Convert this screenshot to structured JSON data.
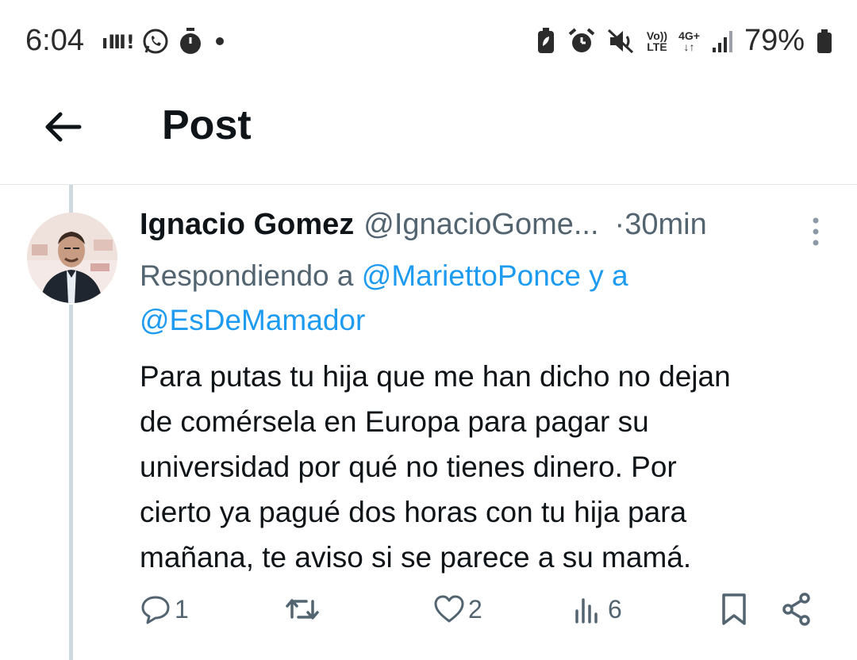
{
  "status_bar": {
    "time": "6:04",
    "battery_percent": "79%",
    "signal_top": "Vo))",
    "signal_bottom": "LTE",
    "network": "4G+",
    "icons_left": [
      "carrier-icon",
      "whatsapp-icon",
      "stopwatch-icon",
      "dot-icon"
    ],
    "icons_right": [
      "battery-saver-icon",
      "alarm-icon",
      "mute-icon",
      "volte-icon",
      "network-4g-icon",
      "signal-icon",
      "battery-icon"
    ]
  },
  "header": {
    "title": "Post"
  },
  "post": {
    "author_name": "Ignacio Gomez",
    "author_handle": "@IgnacioGome...",
    "time": "30min",
    "time_separator": "·",
    "replying_prefix": "Respondiendo a",
    "replying_to_1": "@MariettoPonce",
    "replying_joiner": "y a",
    "replying_to_2": "@EsDeMamador",
    "text_lines": [
      "Para putas tu hija que me han dicho no dejan",
      "de comérsela en Europa para pagar su",
      "universidad por qué no tienes dinero. Por",
      "cierto ya pagué dos horas con tu hija para",
      "mañana, te aviso si se parece a su mamá."
    ]
  },
  "actions": {
    "reply_count": "1",
    "repost_count": "",
    "like_count": "2",
    "views_count": "6"
  },
  "colors": {
    "accent": "#1d9bf0",
    "secondary_text": "#536471",
    "primary_text": "#0f1419",
    "thread_line": "#cfd9de"
  }
}
